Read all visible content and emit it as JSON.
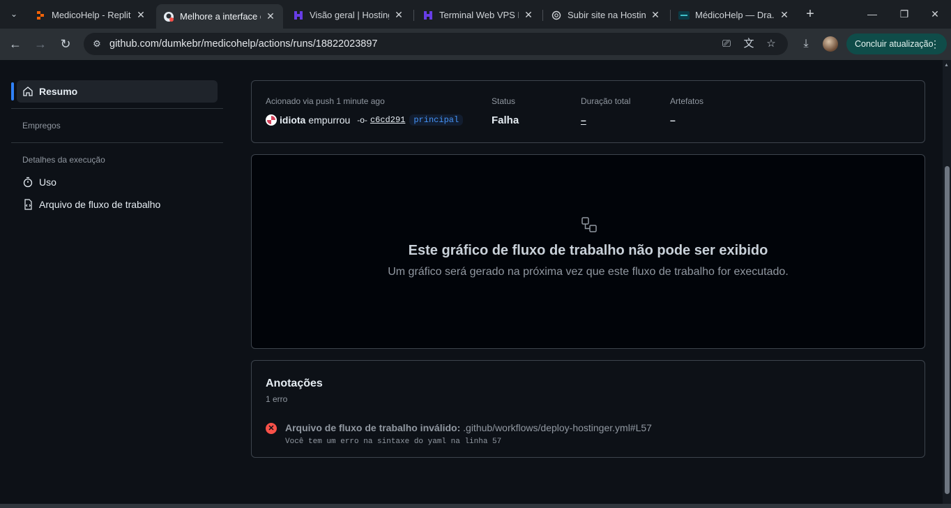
{
  "browser": {
    "tabs": [
      {
        "label": "MedicoHelp - Replit",
        "icon": "replit-icon",
        "active": false
      },
      {
        "label": "Melhore a interface d",
        "icon": "github-icon",
        "active": true
      },
      {
        "label": "Visão geral | Hosting",
        "icon": "hostinger-icon",
        "active": false
      },
      {
        "label": "Terminal Web VPS Ho",
        "icon": "hostinger-icon",
        "active": false
      },
      {
        "label": "Subir site na Hosting",
        "icon": "chatgpt-icon",
        "active": false
      },
      {
        "label": "MédicoHelp — Dra. C",
        "icon": "medicohelp-icon",
        "active": false
      }
    ],
    "url": "github.com/dumkebr/medicohelp/actions/runs/18822023897",
    "update_label": "Concluir atualização"
  },
  "sidebar": {
    "summary_label": "Resumo",
    "jobs_heading": "Empregos",
    "run_details_heading": "Detalhes da execução",
    "usage_label": "Uso",
    "workflow_file_label": "Arquivo de fluxo de trabalho"
  },
  "summary": {
    "trigger_label": "Acionado via push 1 minute ago",
    "actor": "idiota",
    "pushed_text": "empurrou",
    "commit_sha": "c6cd291",
    "branch": "principal",
    "status_label": "Status",
    "status_value": "Falha",
    "duration_label": "Duração total",
    "duration_value": "–",
    "artifacts_label": "Artefatos",
    "artifacts_value": "–"
  },
  "graph": {
    "title": "Este gráfico de fluxo de trabalho não pode ser exibido",
    "subtitle": "Um gráfico será gerado na próxima vez que este fluxo de trabalho for executado."
  },
  "annotations": {
    "title": "Anotações",
    "count": "1 erro",
    "error_title": "Arquivo de fluxo de trabalho inválido:",
    "error_path": ".github/workflows/deploy-hostinger.yml#L57",
    "error_message": "Você tem um erro na sintaxe do yaml na linha 57"
  },
  "colors": {
    "accent": "#2f81f7",
    "error": "#f85149",
    "branch_text": "#4493f8",
    "update_button": "#0f4c49"
  }
}
